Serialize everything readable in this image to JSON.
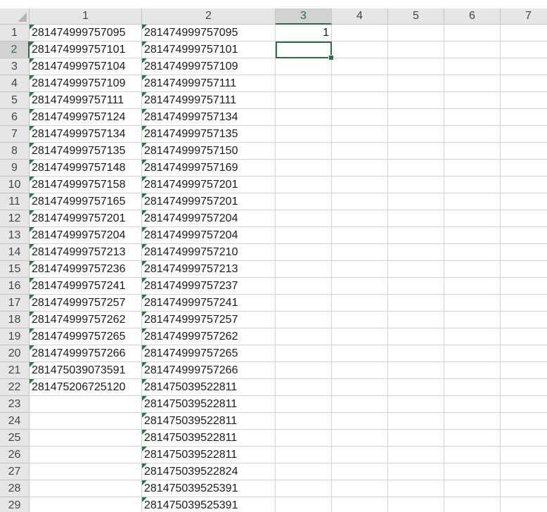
{
  "sheet": {
    "columns": [
      "1",
      "2",
      "3",
      "4",
      "5",
      "6",
      "7"
    ],
    "active_column": "3",
    "active_row": "2",
    "rows": [
      {
        "num": "1",
        "c1": "281474999757095",
        "c2": "281474999757095",
        "c3": "1"
      },
      {
        "num": "2",
        "c1": "281474999757101",
        "c2": "281474999757101",
        "c3": ""
      },
      {
        "num": "3",
        "c1": "281474999757104",
        "c2": "281474999757109",
        "c3": ""
      },
      {
        "num": "4",
        "c1": "281474999757109",
        "c2": "281474999757111",
        "c3": ""
      },
      {
        "num": "5",
        "c1": "281474999757111",
        "c2": "281474999757111",
        "c3": ""
      },
      {
        "num": "6",
        "c1": "281474999757124",
        "c2": "281474999757134",
        "c3": ""
      },
      {
        "num": "7",
        "c1": "281474999757134",
        "c2": "281474999757135",
        "c3": ""
      },
      {
        "num": "8",
        "c1": "281474999757135",
        "c2": "281474999757150",
        "c3": ""
      },
      {
        "num": "9",
        "c1": "281474999757148",
        "c2": "281474999757169",
        "c3": ""
      },
      {
        "num": "10",
        "c1": "281474999757158",
        "c2": "281474999757201",
        "c3": ""
      },
      {
        "num": "11",
        "c1": "281474999757165",
        "c2": "281474999757201",
        "c3": ""
      },
      {
        "num": "12",
        "c1": "281474999757201",
        "c2": "281474999757204",
        "c3": ""
      },
      {
        "num": "13",
        "c1": "281474999757204",
        "c2": "281474999757204",
        "c3": ""
      },
      {
        "num": "14",
        "c1": "281474999757213",
        "c2": "281474999757210",
        "c3": ""
      },
      {
        "num": "15",
        "c1": "281474999757236",
        "c2": "281474999757213",
        "c3": ""
      },
      {
        "num": "16",
        "c1": "281474999757241",
        "c2": "281474999757237",
        "c3": ""
      },
      {
        "num": "17",
        "c1": "281474999757257",
        "c2": "281474999757241",
        "c3": ""
      },
      {
        "num": "18",
        "c1": "281474999757262",
        "c2": "281474999757257",
        "c3": ""
      },
      {
        "num": "19",
        "c1": "281474999757265",
        "c2": "281474999757262",
        "c3": ""
      },
      {
        "num": "20",
        "c1": "281474999757266",
        "c2": "281474999757265",
        "c3": ""
      },
      {
        "num": "21",
        "c1": "281475039073591",
        "c2": "281474999757266",
        "c3": ""
      },
      {
        "num": "22",
        "c1": "281475206725120",
        "c2": "281475039522811",
        "c3": ""
      },
      {
        "num": "23",
        "c1": "",
        "c2": "281475039522811",
        "c3": ""
      },
      {
        "num": "24",
        "c1": "",
        "c2": "281475039522811",
        "c3": ""
      },
      {
        "num": "25",
        "c1": "",
        "c2": "281475039522811",
        "c3": ""
      },
      {
        "num": "26",
        "c1": "",
        "c2": "281475039522811",
        "c3": ""
      },
      {
        "num": "27",
        "c1": "",
        "c2": "281475039522824",
        "c3": ""
      },
      {
        "num": "28",
        "c1": "",
        "c2": "281475039525391",
        "c3": ""
      },
      {
        "num": "29",
        "c1": "",
        "c2": "281475039525391",
        "c3": ""
      }
    ]
  },
  "colors": {
    "header_bg": "#e6e6e6",
    "header_active_bg": "#d2d2d2",
    "accent_green": "#217346",
    "error_triangle": "#1e7f3c",
    "gridline": "#d4d4d4"
  }
}
